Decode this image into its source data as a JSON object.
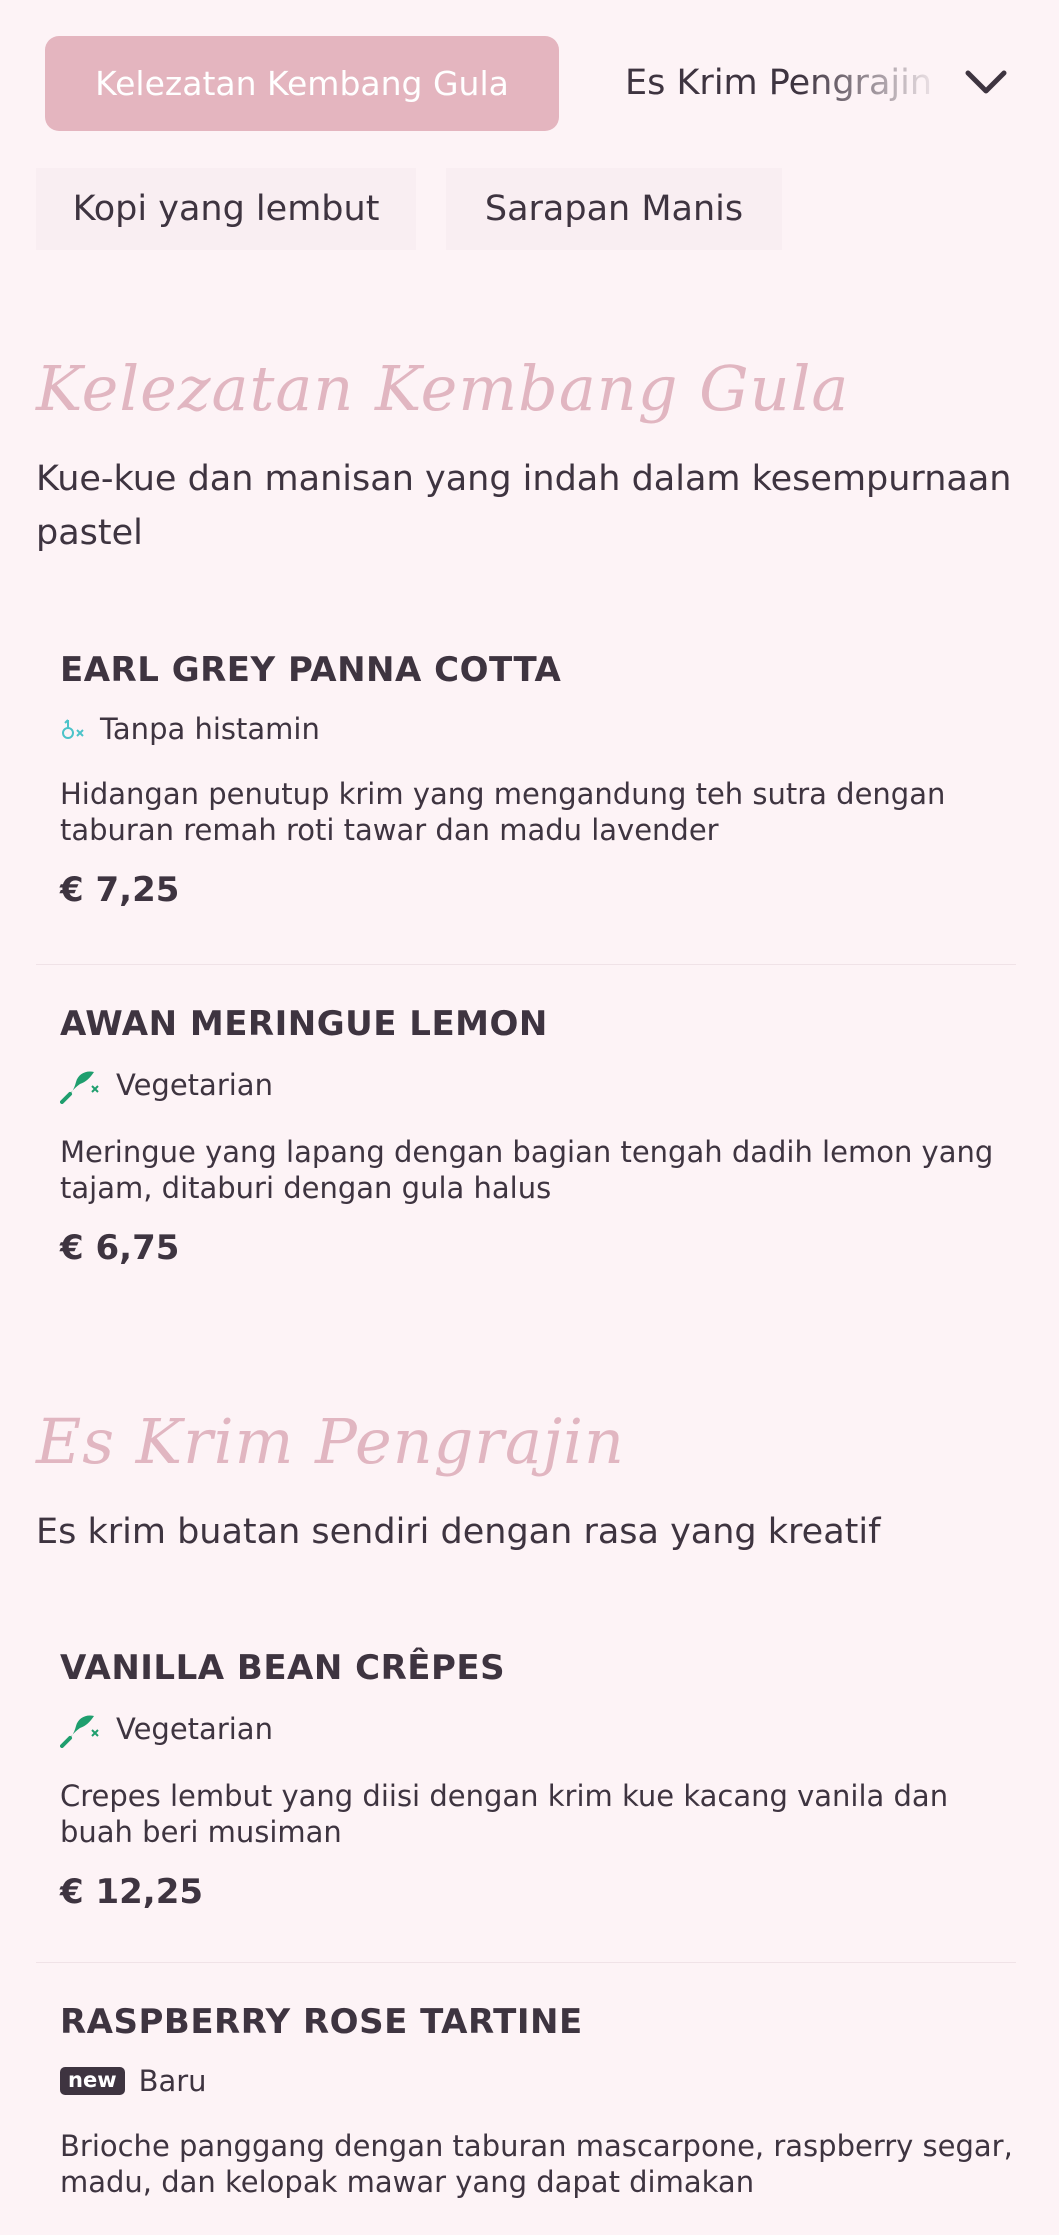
{
  "nav": {
    "active_tab": "Kelezatan Kembang Gula",
    "next_tab": "Es Krim Pengrajin",
    "tabs": [
      "Kopi yang lembut",
      "Sarapan Manis"
    ]
  },
  "sections": [
    {
      "title": "Kelezatan Kembang Gula",
      "description": "Kue-kue dan manisan yang indah dalam kesempurnaan pastel",
      "items": [
        {
          "name": "EARL GREY PANNA COTTA",
          "tag": "Tanpa histamin",
          "tag_icon": "histamine-free-icon",
          "description": "Hidangan penutup krim yang mengandung teh sutra dengan taburan remah roti tawar dan madu lavender",
          "price": "€ 7,25"
        },
        {
          "name": "AWAN MERINGUE LEMON",
          "tag": "Vegetarian",
          "tag_icon": "vegetarian-icon",
          "description": "Meringue yang lapang dengan bagian tengah dadih lemon yang tajam, ditaburi dengan gula halus",
          "price": "€ 6,75"
        }
      ]
    },
    {
      "title": "Es Krim Pengrajin",
      "description": "Es krim buatan sendiri dengan rasa yang kreatif",
      "items": [
        {
          "name": "VANILLA BEAN CRÊPES",
          "tag": "Vegetarian",
          "tag_icon": "vegetarian-icon",
          "description": "Crepes lembut yang diisi dengan krim kue kacang vanila dan buah beri musiman",
          "price": "€ 12,25"
        },
        {
          "name": "RASPBERRY ROSE TARTINE",
          "badge": "new",
          "tag": "Baru",
          "tag_icon": "new-badge-icon",
          "description": "Brioche panggang dengan taburan mascarpone, raspberry segar, madu, dan kelopak mawar yang dapat dimakan"
        }
      ]
    }
  ],
  "colors": {
    "background": "#fdf3f6",
    "accent": "#e4b5bf",
    "title_script": "#e1b6c1",
    "text": "#3e3440",
    "vegetarian_green": "#1f9e6e",
    "histamine_teal": "#4cc3c9"
  }
}
